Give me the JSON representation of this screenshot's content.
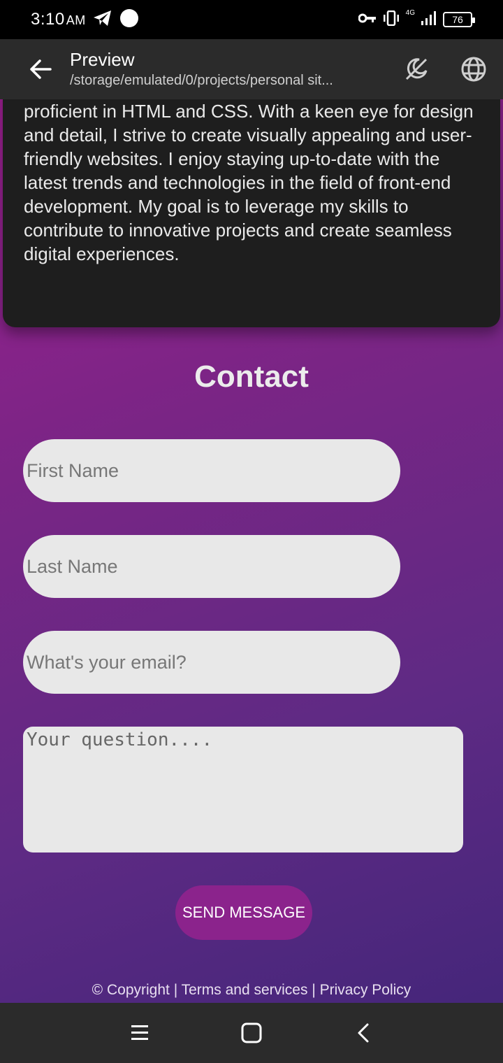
{
  "status": {
    "time": "3:10",
    "ampm": "AM",
    "network": "4G",
    "battery": "76"
  },
  "app_bar": {
    "title": "Preview",
    "subtitle": "/storage/emulated/0/projects/personal sit..."
  },
  "about": {
    "text": "proficient in HTML and CSS. With a keen eye for design and detail, I strive to create visually appealing and user-friendly websites. I enjoy staying up-to-date with the latest trends and technologies in the field of front-end development. My goal is to leverage my skills to contribute to innovative projects and create seamless digital experiences."
  },
  "contact": {
    "title": "Contact",
    "first_name_placeholder": "First Name",
    "last_name_placeholder": "Last Name",
    "email_placeholder": "What's your email?",
    "question_placeholder": "Your question....",
    "send_label": "SEND MESSAGE"
  },
  "footer": {
    "text": "© Copyright | Terms and services | Privacy Policy"
  },
  "colors": {
    "gradient_start": "#9b1f8f",
    "gradient_end": "#45267a",
    "button": "#8b238c"
  }
}
